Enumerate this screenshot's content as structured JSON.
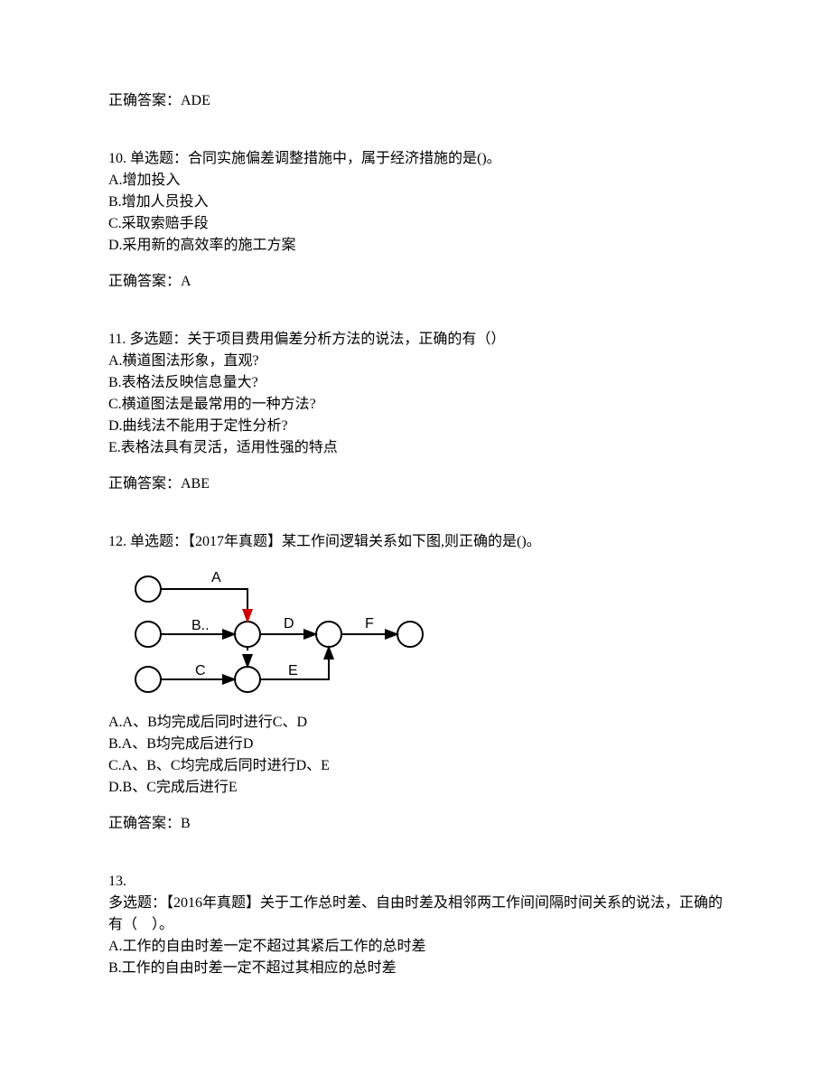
{
  "ans9": {
    "label": "正确答案：ADE"
  },
  "q10": {
    "title": "10.  单选题：合同实施偏差调整措施中，属于经济措施的是()。",
    "a": "A.增加投入",
    "b": "B.增加人员投入",
    "c": "C.采取索赔手段",
    "d": "D.采用新的高效率的施工方案",
    "answer": "正确答案：A"
  },
  "q11": {
    "title": "11.  多选题：关于项目费用偏差分析方法的说法，正确的有（）",
    "a": "A.横道图法形象，直观?",
    "b": "B.表格法反映信息量大?",
    "c": "C.横道图法是最常用的一种方法?",
    "d": "D.曲线法不能用于定性分析?",
    "e": "E.表格法具有灵活，适用性强的特点",
    "answer": "正确答案：ABE"
  },
  "q12": {
    "title": "12.  单选题：【2017年真题】某工作间逻辑关系如下图,则正确的是()。",
    "a": "A.A、B均完成后同时进行C、D",
    "b": "B.A、B均完成后进行D",
    "c": "C.A、B、C均完成后同时进行D、E",
    "d": "D.B、C完成后进行E",
    "answer": "正确答案：B",
    "diagram": {
      "labels": {
        "A": "A",
        "B": "B..",
        "C": "C",
        "D": "D",
        "E": "E",
        "F": "F"
      }
    }
  },
  "q13": {
    "header": "13.",
    "title": "多选题：【2016年真题】关于工作总时差、自由时差及相邻两工作间间隔时间关系的说法，正确的有（　）。",
    "a": "A.工作的自由时差一定不超过其紧后工作的总时差",
    "b": "B.工作的自由时差一定不超过其相应的总时差"
  }
}
